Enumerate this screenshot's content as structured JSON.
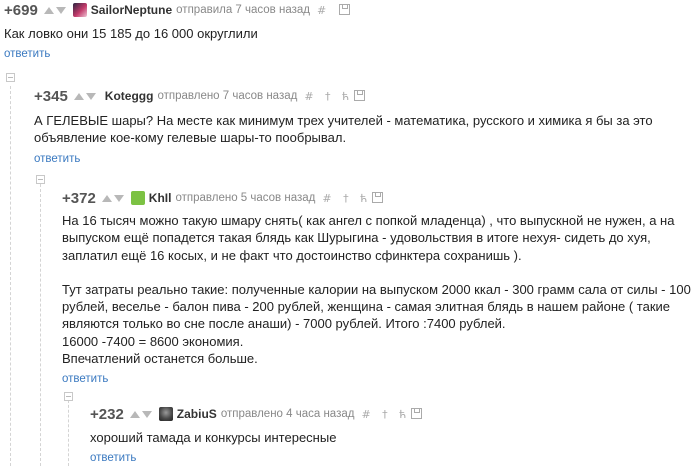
{
  "comments": [
    {
      "rating": "+699",
      "author": "SailorNeptune",
      "meta": "отправила 7 часов назад",
      "actions": "# ",
      "body": "Как ловко они 15 185 до 16 000 округлили",
      "reply": "ответить",
      "avatar_color": "#c23a6a"
    },
    {
      "rating": "+345",
      "author": "Koteggg",
      "meta": "отправлено 7 часов назад",
      "actions": "# † ћ",
      "body": "А ГЕЛЕВЫЕ шары? На месте как минимум трех учителей - математика, русского и химика я бы за это объявление кое-кому гелевые шары-то пообрывал.",
      "reply": "ответить"
    },
    {
      "rating": "+372",
      "author": "KhIl",
      "meta": "отправлено 5 часов назад",
      "actions": "# † ћ",
      "body_lines": [
        "На 16 тысяч можно такую шмару снять( как ангел с попкой младенца) , что выпускной не нужен, а на выпуском ещё попадется такая блядь как Шурыгина - удовольствия в итоге нехуя- сидеть до хуя, заплатил ещё 16 косых, и не факт что достоинство сфинктера сохранишь ).",
        "",
        "Тут затраты реально такие: полученные калории на выпуском 2000 ккал - 300 грамм сала от силы - 100 рублей, веселье - балон пива - 200 рублей, женщина - самая элитная блядь в нашем районе ( такие являются только во сне после анаши) - 7000 рублей. Итого :7400 рублей.",
        "16000 -7400 = 8600 экономия.",
        "Впечатлений останется больше."
      ],
      "reply": "ответить",
      "avatar_color": "#7cc243"
    },
    {
      "rating": "+232",
      "author": "ZabiuS",
      "meta": "отправлено 4 часа назад",
      "actions": "# † ћ",
      "body": "хороший тамада и конкурсы интересные",
      "reply": "ответить",
      "avatar_color": "#4a4a4a"
    }
  ]
}
